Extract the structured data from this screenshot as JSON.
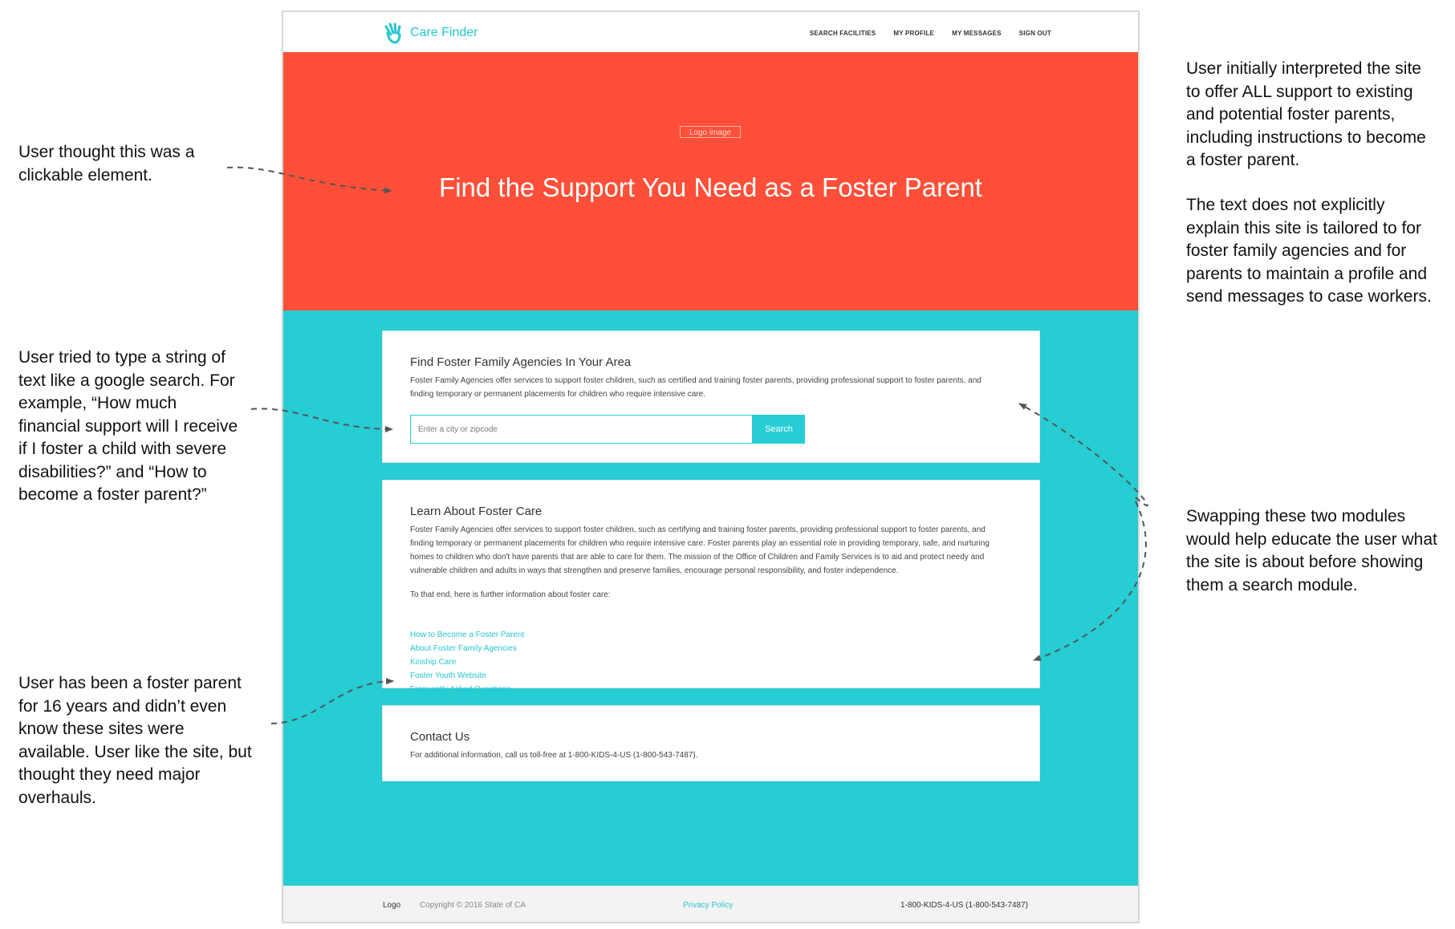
{
  "app": {
    "brand": "Care Finder",
    "nav": [
      "SEARCH FACILITIES",
      "MY PROFILE",
      "MY MESSAGES",
      "SIGN OUT"
    ]
  },
  "hero": {
    "logo_alt": "Logo image",
    "title": "Find the Support You Need as a Foster Parent"
  },
  "search_card": {
    "title": "Find Foster Family Agencies In Your Area",
    "text": "Foster Family Agencies offer services to support foster children, such as certified and training foster parents, providing professional support to foster parents, and finding temporary or permanent placements for children who require intensive care.",
    "placeholder": "Enter a city or zipcode",
    "button": "Search"
  },
  "learn_card": {
    "title": "Learn About Foster Care",
    "text": "Foster Family Agencies offer services to support foster children, such as certifying and training foster parents, providing professional support to foster parents, and finding temporary or permanent placements for children who require intensive care. Foster parents play an essential role in providing temporary, safe, and nurturing homes to children who don't have parents that are able to care for them. The mission of the Office of Children and Family Services is to aid and protect needy and vulnerable children and adults in ways that strengthen and preserve families, encourage personal responsibility, and foster independence.",
    "intro": "To that end, here is further information about foster care:",
    "links": [
      "How to Become a Foster Parent",
      "About Foster Family Agencies",
      "Kinship Care",
      "Foster Youth Website",
      "Frequently Asked Questions"
    ]
  },
  "contact_card": {
    "title": "Contact Us",
    "text": "For additional information, call us toll-free at 1-800-KIDS-4-US (1-800-543-7487)."
  },
  "footer": {
    "logo": "Logo",
    "copyright": "Copyright © 2016 State of CA",
    "privacy": "Privacy Policy",
    "phone": "1-800-KIDS-4-US (1-800-543-7487)"
  },
  "annotations": {
    "clickable": "User thought this was a clickable element.",
    "search": "User tried to type a string of text like a google search. For example, “How much financial support will I receive if I foster a child with severe disabilities?” and “How to become a foster parent?”",
    "links": "User has been a foster parent for 16 years and didn’t even know these sites were available. User like the site, but thought they need major overhauls.",
    "interpretation": "User initially interpreted the site to offer ALL support to existing and potential foster parents, including instructions to become a foster parent.",
    "tailored": "The text does not explicitly explain this site is tailored to for foster family agencies and for parents to maintain a profile and send messages to case workers.",
    "swap": "Swapping these two modules would help educate the user what the site is about before showing them a search module."
  },
  "colors": {
    "hero": "#ff4f38",
    "teal": "#26cdd3",
    "accent": "#26c6cf"
  }
}
